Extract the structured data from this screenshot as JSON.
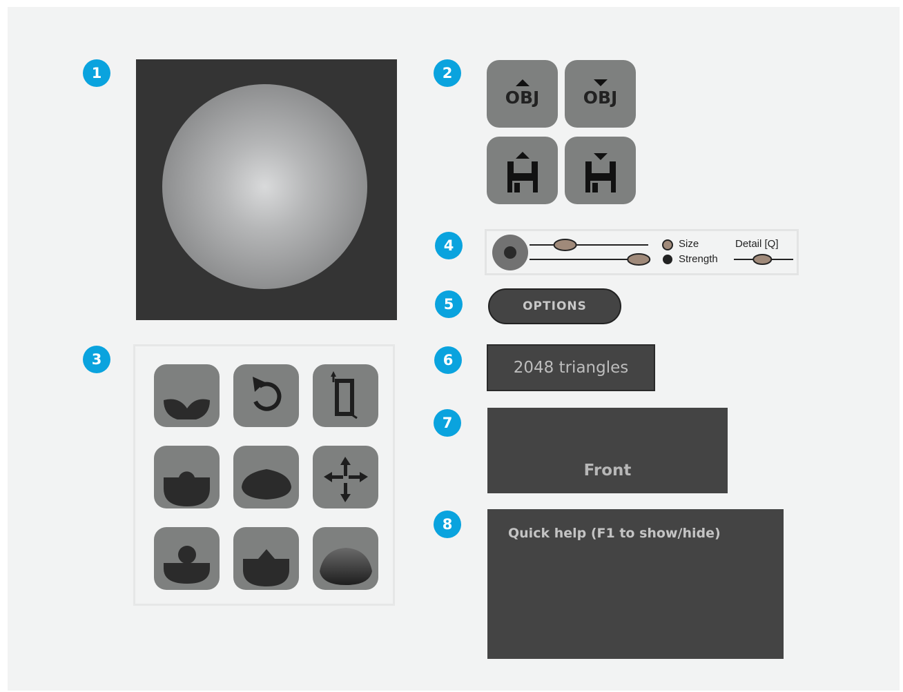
{
  "badges": [
    "1",
    "2",
    "3",
    "4",
    "5",
    "6",
    "7",
    "8"
  ],
  "io_buttons": {
    "import_obj": {
      "label": "OBJ",
      "icon": "arrow-up-icon"
    },
    "export_obj": {
      "label": "OBJ",
      "icon": "arrow-down-icon"
    },
    "load_scene": {
      "icon": "floppy-load-icon"
    },
    "save_scene": {
      "icon": "floppy-save-icon"
    }
  },
  "tools": [
    {
      "icon": "brush-pinch-icon"
    },
    {
      "icon": "undo-rotate-icon"
    },
    {
      "icon": "crop-frame-icon"
    },
    {
      "icon": "brush-blob-icon"
    },
    {
      "icon": "brush-dome-icon"
    },
    {
      "icon": "move-arrows-icon"
    },
    {
      "icon": "brush-head-icon"
    },
    {
      "icon": "brush-peak-icon"
    },
    {
      "icon": "brush-smooth-icon"
    }
  ],
  "brush": {
    "size_label": "Size",
    "strength_label": "Strength",
    "detail_label": "Detail [Q]",
    "size_value": 0.3,
    "strength_value": 0.92,
    "detail_value": 0.48
  },
  "options_label": "OPTIONS",
  "triangles_text": "2048 triangles",
  "view_label": "Front",
  "help_title": "Quick help (F1 to show/hide)",
  "colors": {
    "badge": "#0aa3de",
    "slider_knob": "#a08a7a",
    "panel_dark": "#444444"
  }
}
